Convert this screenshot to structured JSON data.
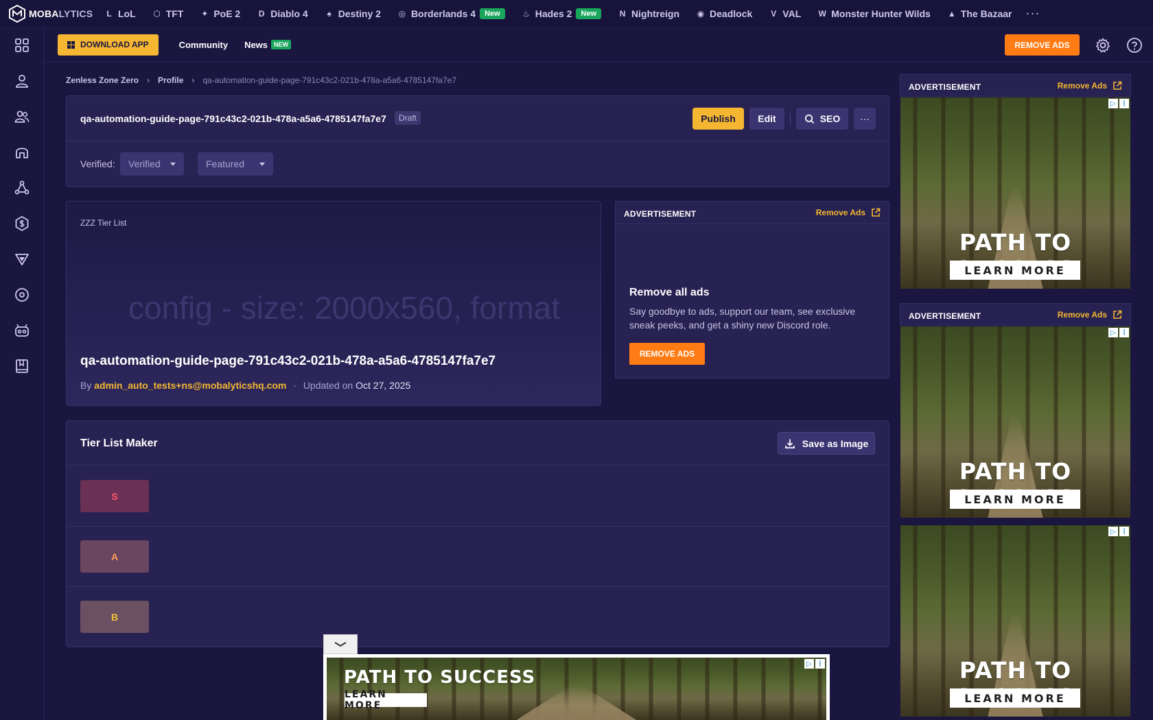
{
  "topnav": {
    "logo_a": "MOBA",
    "logo_b": "LYTICS",
    "items": [
      {
        "label": "LoL",
        "icon": "lol-icon",
        "glyph": "L"
      },
      {
        "label": "TFT",
        "icon": "tft-icon",
        "glyph": "⬡"
      },
      {
        "label": "PoE 2",
        "icon": "poe-icon",
        "glyph": "✦"
      },
      {
        "label": "Diablo 4",
        "icon": "diablo-icon",
        "glyph": "D"
      },
      {
        "label": "Destiny 2",
        "icon": "destiny-icon",
        "glyph": "♠"
      },
      {
        "label": "Borderlands 4",
        "icon": "borderlands-icon",
        "glyph": "◎",
        "badge": "New"
      },
      {
        "label": "Hades 2",
        "icon": "hades-icon",
        "glyph": "♨",
        "badge": "New"
      },
      {
        "label": "Nightreign",
        "icon": "nightreign-icon",
        "glyph": "N"
      },
      {
        "label": "Deadlock",
        "icon": "deadlock-icon",
        "glyph": "◉"
      },
      {
        "label": "VAL",
        "icon": "valorant-icon",
        "glyph": "V"
      },
      {
        "label": "Monster Hunter Wilds",
        "icon": "monster-hunter-icon",
        "glyph": "W"
      },
      {
        "label": "The Bazaar",
        "icon": "bazaar-icon",
        "glyph": "▲"
      }
    ],
    "more": "···"
  },
  "subbar": {
    "download": "DOWNLOAD APP",
    "community": "Community",
    "news": "News",
    "news_badge": "NEW",
    "remove_ads": "REMOVE ADS"
  },
  "breadcrumb": {
    "items": [
      "Zenless Zone Zero",
      "Profile"
    ],
    "current": "qa-automation-guide-page-791c43c2-021b-478a-a5a6-4785147fa7e7",
    "sep": "›"
  },
  "header": {
    "title": "qa-automation-guide-page-791c43c2-021b-478a-a5a6-4785147fa7e7",
    "status": "Draft",
    "publish": "Publish",
    "edit": "Edit",
    "seo": "SEO",
    "more": "···",
    "verified_label": "Verified:",
    "verified_value": "Verified",
    "featured_value": "Featured"
  },
  "hero": {
    "tag": "ZZZ Tier List",
    "ghost": "config - size: 2000x560, format",
    "title": "qa-automation-guide-page-791c43c2-021b-478a-a5a6-4785147fa7e7",
    "by": "By",
    "author": "admin_auto_tests+ns@mobalyticshq.com",
    "dot": "·",
    "updated": "Updated on",
    "date": "Oct 27, 2025"
  },
  "ad_mid": {
    "label": "ADVERTISEMENT",
    "remove": "Remove Ads",
    "heading": "Remove all ads",
    "body": "Say goodbye to ads, support our team, see exclusive sneak peeks, and get a shiny new Discord role.",
    "button": "REMOVE ADS"
  },
  "tier_maker": {
    "title": "Tier List Maker",
    "save": "Save as Image",
    "tiers": [
      {
        "label": "S",
        "bg": "#6b3155",
        "fg": "#ff5a6e"
      },
      {
        "label": "A",
        "bg": "#6b4660",
        "fg": "#ff9a5a"
      },
      {
        "label": "B",
        "bg": "#6b5062",
        "fg": "#f5c33b"
      }
    ]
  },
  "right_ads": {
    "label": "ADVERTISEMENT",
    "remove": "Remove Ads"
  },
  "ad_creative": {
    "headline": "PATH TO SUCCESS",
    "cta": "LEARN MORE"
  },
  "colors": {
    "accent": "#f5b731",
    "orange": "#ff7b13",
    "bg": "#1a1640",
    "card": "#282252"
  }
}
